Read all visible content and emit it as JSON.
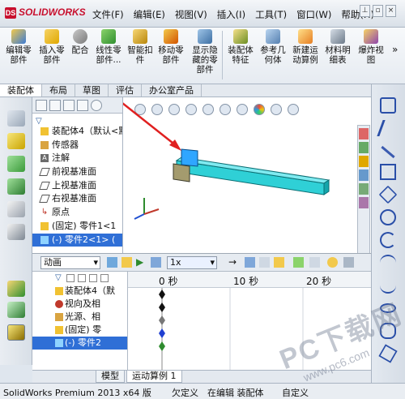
{
  "app": {
    "logo_text": "SOLIDWORKS",
    "logo_mark": "DS"
  },
  "menu": [
    "文件(F)",
    "编辑(E)",
    "视图(V)",
    "插入(I)",
    "工具(T)",
    "窗口(W)",
    "帮助(H)"
  ],
  "ribbon": [
    {
      "label": "编辑零\n部件",
      "icon": "edit-component-icon"
    },
    {
      "label": "插入零\n部件",
      "icon": "insert-component-icon"
    },
    {
      "label": "配合",
      "icon": "mate-icon"
    },
    {
      "label": "线性零\n部件...",
      "icon": "linear-pattern-icon"
    },
    {
      "label": "智能扣\n件",
      "icon": "smart-fastener-icon"
    },
    {
      "label": "移动零\n部件",
      "icon": "move-component-icon"
    },
    {
      "label": "显示隐\n藏的零\n部件",
      "icon": "show-hidden-icon"
    },
    {
      "label": "装配体\n特征",
      "icon": "assembly-feature-icon"
    },
    {
      "label": "参考几\n何体",
      "icon": "reference-geometry-icon"
    },
    {
      "label": "新建运\n动算例",
      "icon": "new-motion-study-icon"
    },
    {
      "label": "材料明\n细表",
      "icon": "bom-icon"
    },
    {
      "label": "爆炸视\n图",
      "icon": "exploded-view-icon"
    }
  ],
  "command_tabs": [
    "装配体",
    "布局",
    "草图",
    "评估",
    "办公室产品"
  ],
  "tree": [
    {
      "label": "装配体4（默认<默",
      "icon": "assembly-icon"
    },
    {
      "label": "传感器",
      "icon": "sensor-icon"
    },
    {
      "label": "注解",
      "icon": "annotation-icon"
    },
    {
      "label": "前视基准面",
      "icon": "plane-icon"
    },
    {
      "label": "上视基准面",
      "icon": "plane-icon"
    },
    {
      "label": "右视基准面",
      "icon": "plane-icon"
    },
    {
      "label": "原点",
      "icon": "origin-icon"
    },
    {
      "label": "(固定) 零件1<1",
      "icon": "part-icon"
    },
    {
      "label": "(-) 零件2<1> (",
      "icon": "part-icon"
    }
  ],
  "motion": {
    "study_type": "动画",
    "speed": "1x",
    "tree": [
      {
        "label": "装配体4（默",
        "icon": "assembly-icon"
      },
      {
        "label": "视向及相",
        "icon": "view-orientation-icon"
      },
      {
        "label": "光源、相",
        "icon": "lights-icon"
      },
      {
        "label": "(固定) 零",
        "icon": "part-icon"
      },
      {
        "label": "(-) 零件2",
        "icon": "part-icon"
      }
    ],
    "ticks": [
      "0 秒",
      "10 秒",
      "20 秒"
    ]
  },
  "bottom_tabs": [
    "模型",
    "运动算例 1"
  ],
  "status": {
    "version": "SolidWorks Premium 2013 x64 版",
    "state1": "欠定义",
    "state2": "在编辑 装配体",
    "state3": "自定义"
  },
  "watermark": {
    "line1": "PC下载网",
    "line2": "www.pc6.com"
  },
  "colors": {
    "part_body": "#2fd0d6",
    "selected_part": "#2fa6ff",
    "arrow": "#e02020",
    "selection": "#2f6fd6"
  }
}
